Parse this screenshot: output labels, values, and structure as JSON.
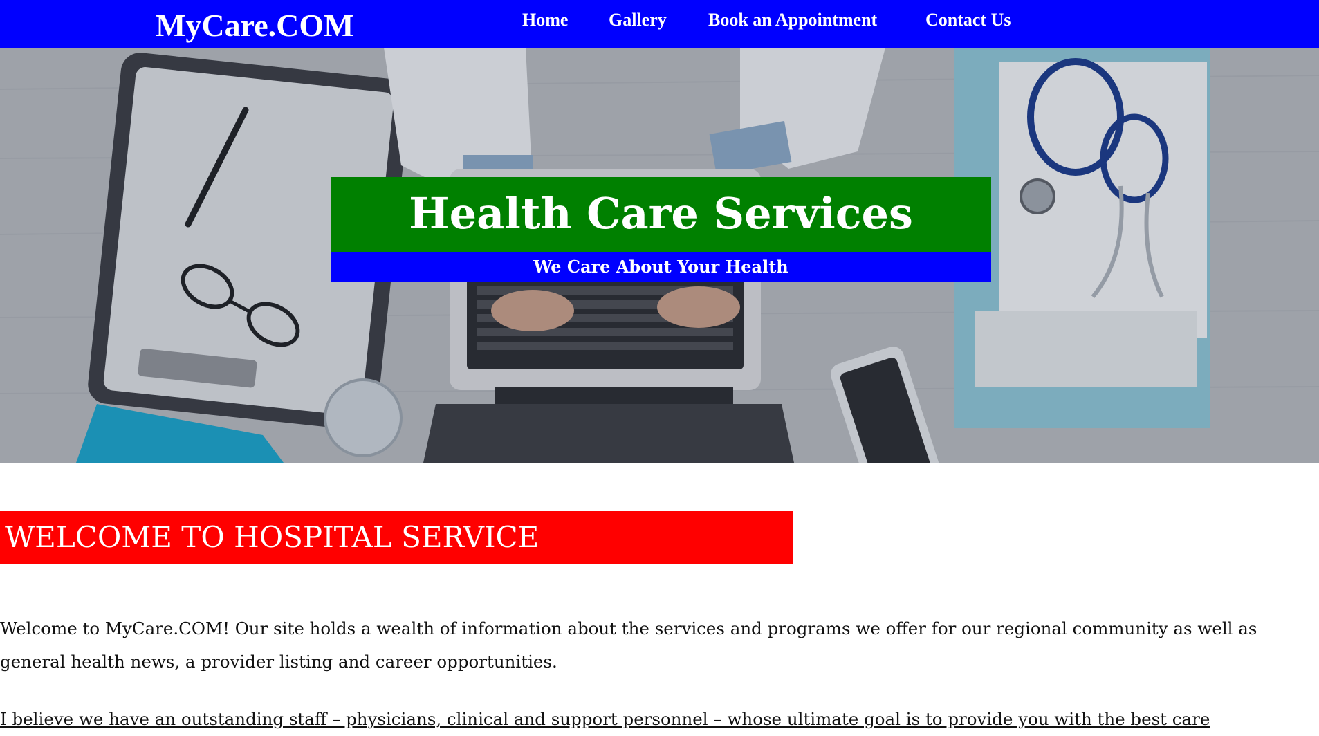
{
  "navbar": {
    "brand": "MyCare.COM",
    "links": [
      {
        "label": "Home"
      },
      {
        "label": "Gallery"
      },
      {
        "label": "Book an Appointment"
      },
      {
        "label": "Contact Us"
      }
    ]
  },
  "hero": {
    "title": "Health Care Services",
    "subtitle": "We Care About Your Health"
  },
  "main": {
    "welcome_heading": "WELCOME TO HOSPITAL SERVICE",
    "paragraph1_line1": "Welcome to MyCare.COM! Our site holds a wealth of information about the services and programs we offer for our regional community as well as",
    "paragraph1_line2": "general health news, a provider listing and career opportunities.",
    "paragraph2": "I believe we have an outstanding staff – physicians, clinical and support personnel – whose ultimate goal is to provide you with the best care"
  },
  "colors": {
    "nav_bg": "#0000ff",
    "title_bg": "#008000",
    "subtitle_bg": "#0000ff",
    "welcome_bg": "#ff0000"
  }
}
